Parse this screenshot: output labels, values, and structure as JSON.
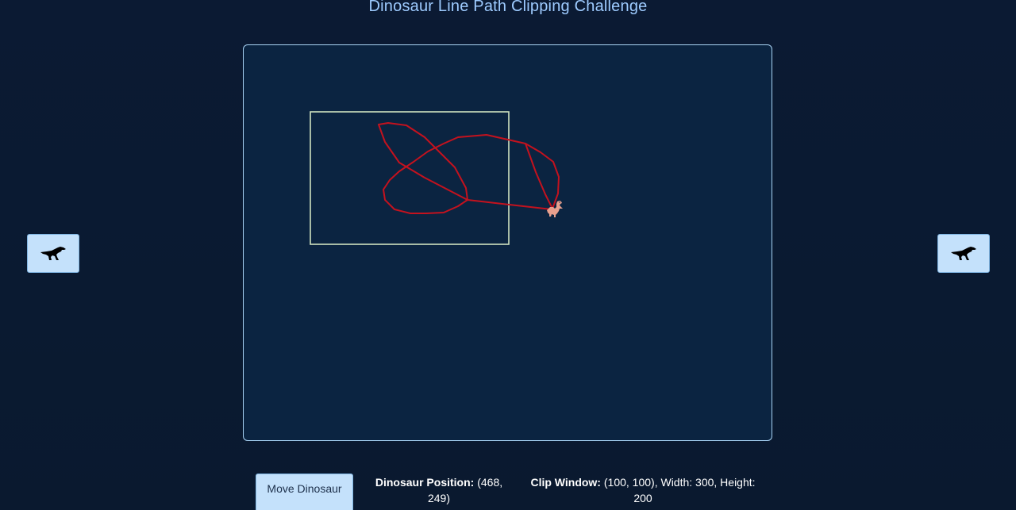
{
  "title": "Dinosaur Line Path Clipping Challenge",
  "left_button": {
    "icon": "dinosaur-icon"
  },
  "right_button": {
    "icon": "dinosaur-icon"
  },
  "move_button": {
    "label": "Move Dinosaur"
  },
  "position_info": {
    "label": "Dinosaur Position:",
    "value": "(468, 249)"
  },
  "clip_info": {
    "label": "Clip Window:",
    "value": "(100, 100), Width: 300, Height: 200"
  },
  "canvas": {
    "background": "#0b2441",
    "border_color": "#a9d4f5",
    "clip_window_color": "#cfe3c0",
    "path_color": "#c4121e",
    "dino_color": "#e8a08e"
  },
  "colors": {
    "page_bg": "#0a1930",
    "title": "#9ecbff",
    "button_bg": "#c4e1fb"
  }
}
